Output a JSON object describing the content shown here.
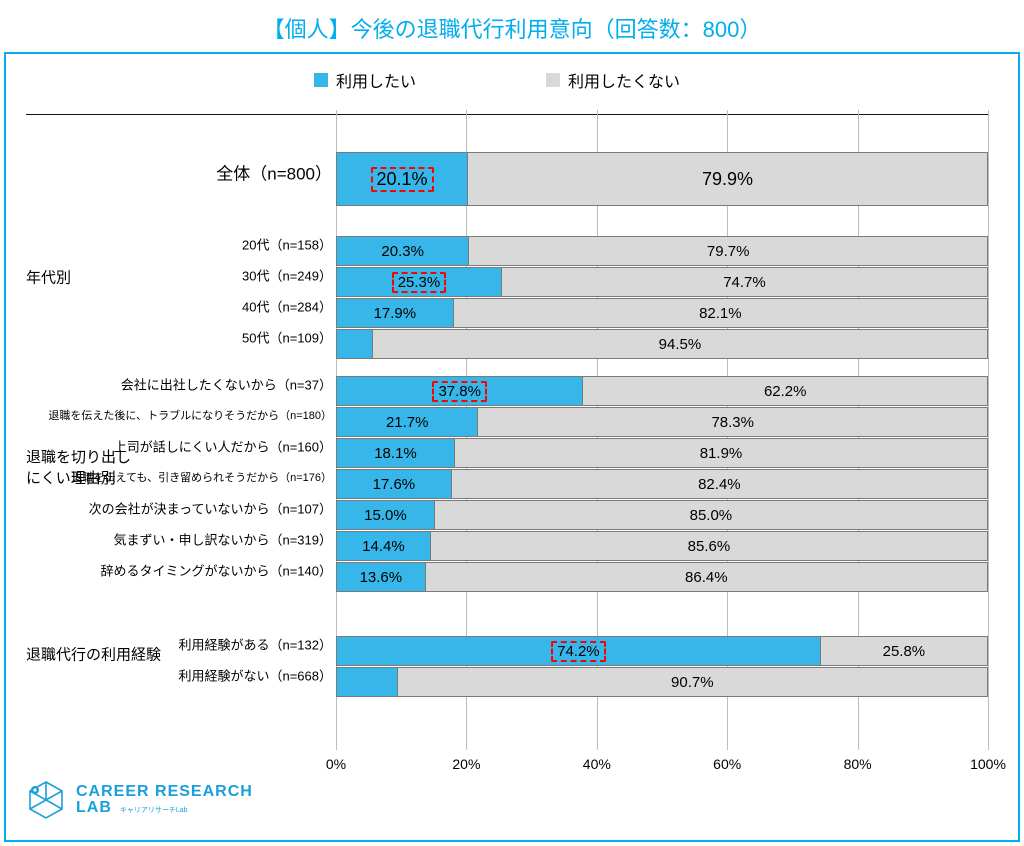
{
  "title": "【個人】今後の退職代行利用意向（回答数：800）",
  "legend": {
    "yes": "利用したい",
    "no": "利用したくない"
  },
  "ticks": [
    "0%",
    "20%",
    "40%",
    "60%",
    "80%",
    "100%"
  ],
  "rows": {
    "all": {
      "label": "全体（n=800）",
      "yes": 20.1,
      "no": 79.9,
      "hi": true
    },
    "g0": {
      "label": "20代（n=158）",
      "yes": 20.3,
      "no": 79.7
    },
    "g1": {
      "label": "30代（n=249）",
      "yes": 25.3,
      "no": 74.7,
      "hi": true
    },
    "g2": {
      "label": "40代（n=284）",
      "yes": 17.9,
      "no": 82.1
    },
    "g3": {
      "label": "50代（n=109）",
      "yes": 5.5,
      "no": 94.5
    },
    "d0": {
      "label": "会社に出社したくないから（n=37）",
      "yes": 37.8,
      "no": 62.2,
      "hi": true
    },
    "d1": {
      "label": "退職を伝えた後に、トラブルになりそうだから（n=180）",
      "yes": 21.7,
      "no": 78.3
    },
    "d2": {
      "label": "上司が話しにくい人だから（n=160）",
      "yes": 18.1,
      "no": 81.9
    },
    "d3": {
      "label": "退職を伝えても、引き留められそうだから（n=176）",
      "yes": 17.6,
      "no": 82.4
    },
    "d4": {
      "label": "次の会社が決まっていないから（n=107）",
      "yes": 15.0,
      "no": 85.0
    },
    "d5": {
      "label": "気まずい・申し訳ないから（n=319）",
      "yes": 14.4,
      "no": 85.6
    },
    "d6": {
      "label": "辞めるタイミングがないから（n=140）",
      "yes": 13.6,
      "no": 86.4
    },
    "e0": {
      "label": "利用経験がある（n=132）",
      "yes": 74.2,
      "no": 25.8,
      "hi": true
    },
    "e1": {
      "label": "利用経験がない（n=668）",
      "yes": 9.3,
      "no": 90.7
    }
  },
  "sections": {
    "age": "年代別",
    "diff": "退職を切り出しにくい理由別",
    "exp": "退職代行の利用経験"
  },
  "logo": {
    "l1": "CAREER RESEARCH",
    "l2": "LAB",
    "sub": "キャリアリサーチLab"
  },
  "chart_data": {
    "type": "bar",
    "orientation": "horizontal-stacked",
    "title": "【個人】今後の退職代行利用意向（回答数：800）",
    "xlabel": "",
    "ylabel": "",
    "xlim": [
      0,
      100
    ],
    "x_ticks": [
      0,
      20,
      40,
      60,
      80,
      100
    ],
    "series": [
      {
        "name": "利用したい"
      },
      {
        "name": "利用したくない"
      }
    ],
    "groups": [
      {
        "name": "全体",
        "rows": [
          {
            "label": "全体（n=800）",
            "values": [
              20.1,
              79.9
            ]
          }
        ]
      },
      {
        "name": "年代別",
        "rows": [
          {
            "label": "20代（n=158）",
            "values": [
              20.3,
              79.7
            ]
          },
          {
            "label": "30代（n=249）",
            "values": [
              25.3,
              74.7
            ]
          },
          {
            "label": "40代（n=284）",
            "values": [
              17.9,
              82.1
            ]
          },
          {
            "label": "50代（n=109）",
            "values": [
              5.5,
              94.5
            ]
          }
        ]
      },
      {
        "name": "退職を切り出しにくい理由別",
        "rows": [
          {
            "label": "会社に出社したくないから（n=37）",
            "values": [
              37.8,
              62.2
            ]
          },
          {
            "label": "退職を伝えた後に、トラブルになりそうだから（n=180）",
            "values": [
              21.7,
              78.3
            ]
          },
          {
            "label": "上司が話しにくい人だから（n=160）",
            "values": [
              18.1,
              81.9
            ]
          },
          {
            "label": "退職を伝えても、引き留められそうだから（n=176）",
            "values": [
              17.6,
              82.4
            ]
          },
          {
            "label": "次の会社が決まっていないから（n=107）",
            "values": [
              15.0,
              85.0
            ]
          },
          {
            "label": "気まずい・申し訳ないから（n=319）",
            "values": [
              14.4,
              85.6
            ]
          },
          {
            "label": "辞めるタイミングがないから（n=140）",
            "values": [
              13.6,
              86.4
            ]
          }
        ]
      },
      {
        "name": "退職代行の利用経験",
        "rows": [
          {
            "label": "利用経験がある（n=132）",
            "values": [
              74.2,
              25.8
            ]
          },
          {
            "label": "利用経験がない（n=668）",
            "values": [
              9.3,
              90.7
            ]
          }
        ]
      }
    ]
  }
}
